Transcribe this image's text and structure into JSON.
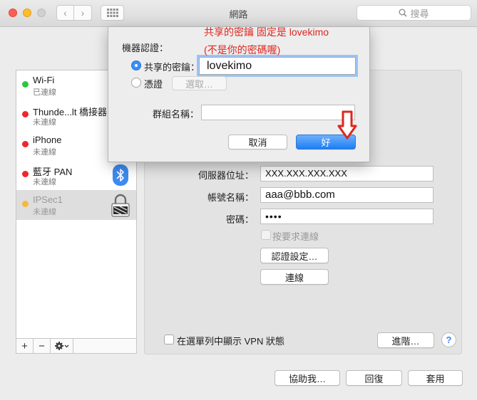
{
  "window": {
    "title": "網路",
    "search_placeholder": "搜尋",
    "traffic_colors": [
      "#fd5f57",
      "#febc2e",
      "#c9c9c9"
    ]
  },
  "sidebar": {
    "items": [
      {
        "name": "Wi-Fi",
        "status": "已連線",
        "dot": "#2ac840"
      },
      {
        "name": "Thunde...lt 橋接器",
        "status": "未連線",
        "dot": "#f0262c"
      },
      {
        "name": "iPhone",
        "status": "未連線",
        "dot": "#f0262c"
      },
      {
        "name": "藍牙 PAN",
        "status": "未連線",
        "dot": "#f0262c"
      },
      {
        "name": "IPSec1",
        "status": "未連線",
        "dot": "#f6b93c"
      }
    ],
    "tools": {
      "add": "+",
      "remove": "−"
    }
  },
  "vpn": {
    "server_label": "伺服器位址：",
    "server_value": "XXX.XXX.XXX.XXX",
    "account_label": "帳號名稱：",
    "account_value": "aaa@bbb.com",
    "password_label": "密碼：",
    "password_value": "••••",
    "on_demand_label": "按要求連線",
    "auth_button": "認證設定…",
    "connect_button": "連線"
  },
  "footer": {
    "show_vpn_label": "在選單列中顯示 VPN 狀態",
    "advanced_button": "進階…",
    "help_label": "?",
    "assist_button": "協助我…",
    "revert_button": "回復",
    "apply_button": "套用"
  },
  "dialog": {
    "section_label": "機器認證：",
    "shared_secret_label": "共享的密鑰：",
    "shared_secret_value": "lovekimo",
    "certificate_label": "憑證",
    "select_button": "選取…",
    "group_label": "群組名稱：",
    "group_value": "",
    "cancel_button": "取消",
    "ok_button": "好",
    "accent": "#3a8ef6"
  },
  "annotation": {
    "line1": "共享的密鑰 固定是 lovekimo",
    "line2": "(不是你的密碼喔)",
    "color": "#e0261e"
  }
}
